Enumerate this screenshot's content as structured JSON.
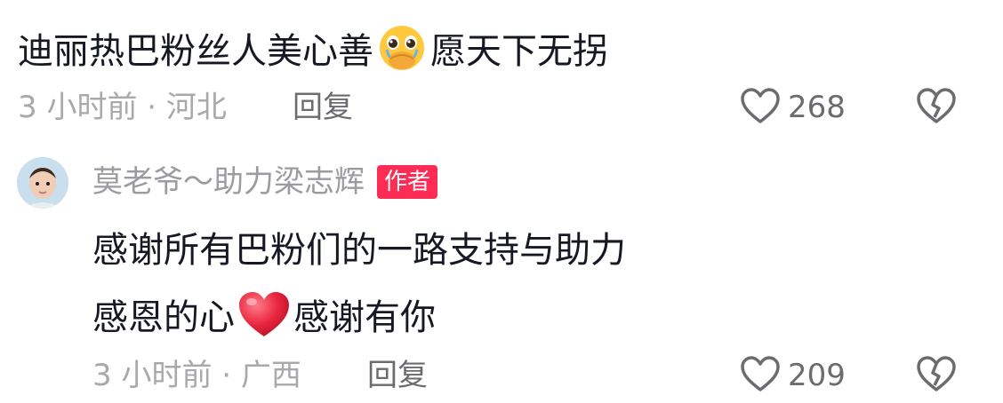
{
  "comments": [
    {
      "text_before": "迪丽热巴粉丝人美心善",
      "emoji": "pleading-face-with-hands",
      "text_after": "愿天下无拐",
      "time": "3 小时前",
      "dot": "·",
      "location": "河北",
      "reply_label": "回复",
      "likes": "268"
    }
  ],
  "reply": {
    "username": "莫老爷～助力梁志辉",
    "badge": "作者",
    "line1": "感谢所有巴粉们的一路支持与助力",
    "line2_before": "感恩的心",
    "emoji": "red-heart",
    "line2_after": "感谢有你",
    "time": "3 小时前",
    "dot": "·",
    "location": "广西",
    "reply_label": "回复",
    "likes": "209"
  },
  "colors": {
    "badge": "#fe2c55",
    "heart": "#e8243d",
    "text": "#161823",
    "meta": "#a8a8ad"
  }
}
